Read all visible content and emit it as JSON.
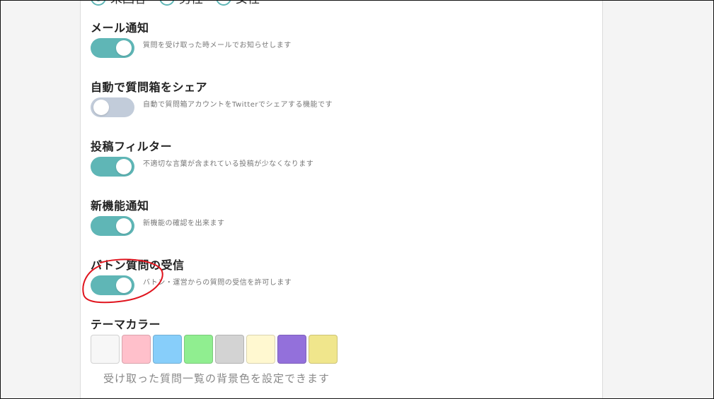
{
  "gender": {
    "options": [
      {
        "label": "未回答",
        "checked": true
      },
      {
        "label": "男性",
        "checked": false
      },
      {
        "label": "女性",
        "checked": false
      }
    ]
  },
  "settings": {
    "mail_notify": {
      "title": "メール通知",
      "desc": "質問を受け取った時メールでお知らせします",
      "enabled": true
    },
    "auto_share": {
      "title": "自動で質問箱をシェア",
      "desc": "自動で質問箱アカウントをTwitterでシェアする機能です",
      "enabled": false
    },
    "post_filter": {
      "title": "投稿フィルター",
      "desc": "不適切な言葉が含まれている投稿が少なくなります",
      "enabled": true
    },
    "new_feature": {
      "title": "新機能通知",
      "desc": "新機能の確認を出来ます",
      "enabled": true
    },
    "baton": {
      "title": "バトン質問の受信",
      "desc": "バトン・運営からの質問の受信を許可します",
      "enabled": true
    }
  },
  "theme": {
    "title": "テーマカラー",
    "desc": "受け取った質問一覧の背景色を設定できます",
    "colors": [
      "#f7f7f7",
      "#ffc0cb",
      "#87cefa",
      "#90ee90",
      "#d3d3d3",
      "#fff8d0",
      "#9370db",
      "#f0e68c"
    ]
  },
  "colors": {
    "accent": "#5fb6b6",
    "toggle_off": "#c2ccda",
    "annotation": "#e0141e"
  }
}
